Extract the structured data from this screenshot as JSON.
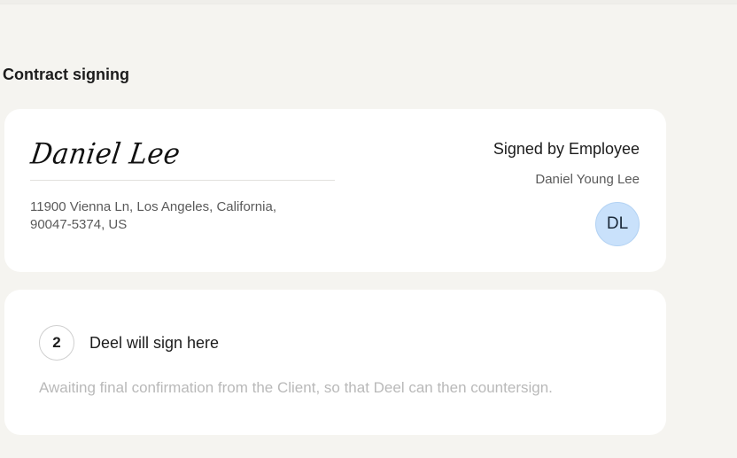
{
  "section": {
    "title": "Contract signing"
  },
  "employee_signature": {
    "signature_text": "Daniel Lee",
    "address": "11900 Vienna Ln, Los Angeles, California, 90047-5374, US",
    "status": "Signed by Employee",
    "signer_name": "Daniel Young Lee",
    "avatar_initials": "DL",
    "avatar_color": "#c9e1fb"
  },
  "deel_step": {
    "step_number": "2",
    "title": "Deel will sign here",
    "description": "Awaiting final confirmation from the Client, so that Deel can then countersign."
  }
}
